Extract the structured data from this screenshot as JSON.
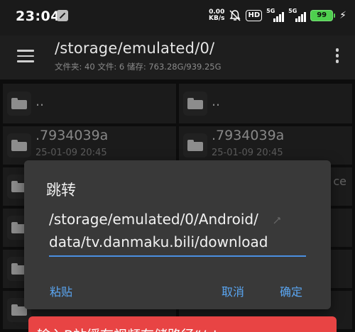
{
  "status_bar": {
    "time": "23:04",
    "net_speed_value": "0.00",
    "net_speed_unit": "KB/s",
    "hd": "HD",
    "sim1": "5G",
    "sim2": "5G",
    "battery": "99"
  },
  "app_bar": {
    "path": "/storage/emulated/0/",
    "summary": "文件夹: 40  文件: 6  储存: 763.28G/939.25G"
  },
  "files": [
    {
      "name": "..",
      "date": ""
    },
    {
      "name": "..",
      "date": ""
    },
    {
      "name": ".7934039a",
      "date": "25-01-09 20:45"
    },
    {
      "name": ".7934039a",
      "date": "25-01-09 20:45"
    }
  ],
  "partial_text": "ce",
  "dialog": {
    "title": "跳转",
    "path_line1": "/storage/emulated/0/Android/",
    "path_line2": "data/tv.danmaku.bili/download",
    "paste_label": "粘贴",
    "cancel_label": "取消",
    "ok_label": "确定"
  },
  "toast": {
    "text": "输入B站缓存视频存储路径“/st"
  },
  "colors": {
    "accent": "#5aa6f2",
    "toast": "#e84444",
    "battery": "#4ed04e"
  }
}
